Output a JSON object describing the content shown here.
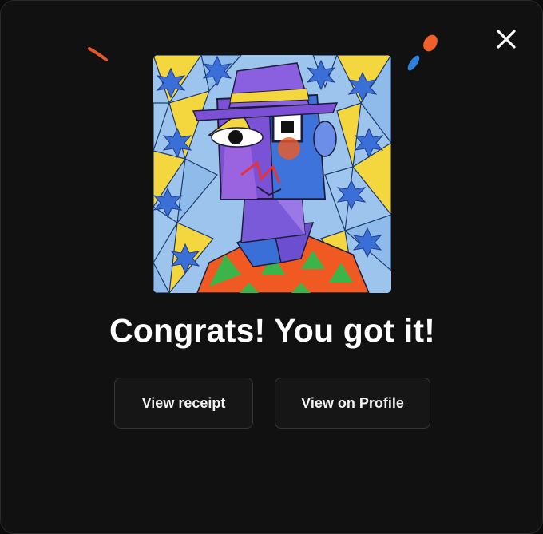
{
  "modal": {
    "title": "Congrats! You got it!",
    "close_icon": "close-icon",
    "artwork_icon": "cubist-portrait-artwork"
  },
  "buttons": {
    "view_receipt": "View receipt",
    "view_on_profile": "View on Profile"
  },
  "colors": {
    "background": "#111111",
    "text": "#ffffff",
    "button_bg": "#161616",
    "button_border": "#363636",
    "confetti_orange": "#f0602a",
    "confetti_blue": "#2f7fdc"
  }
}
